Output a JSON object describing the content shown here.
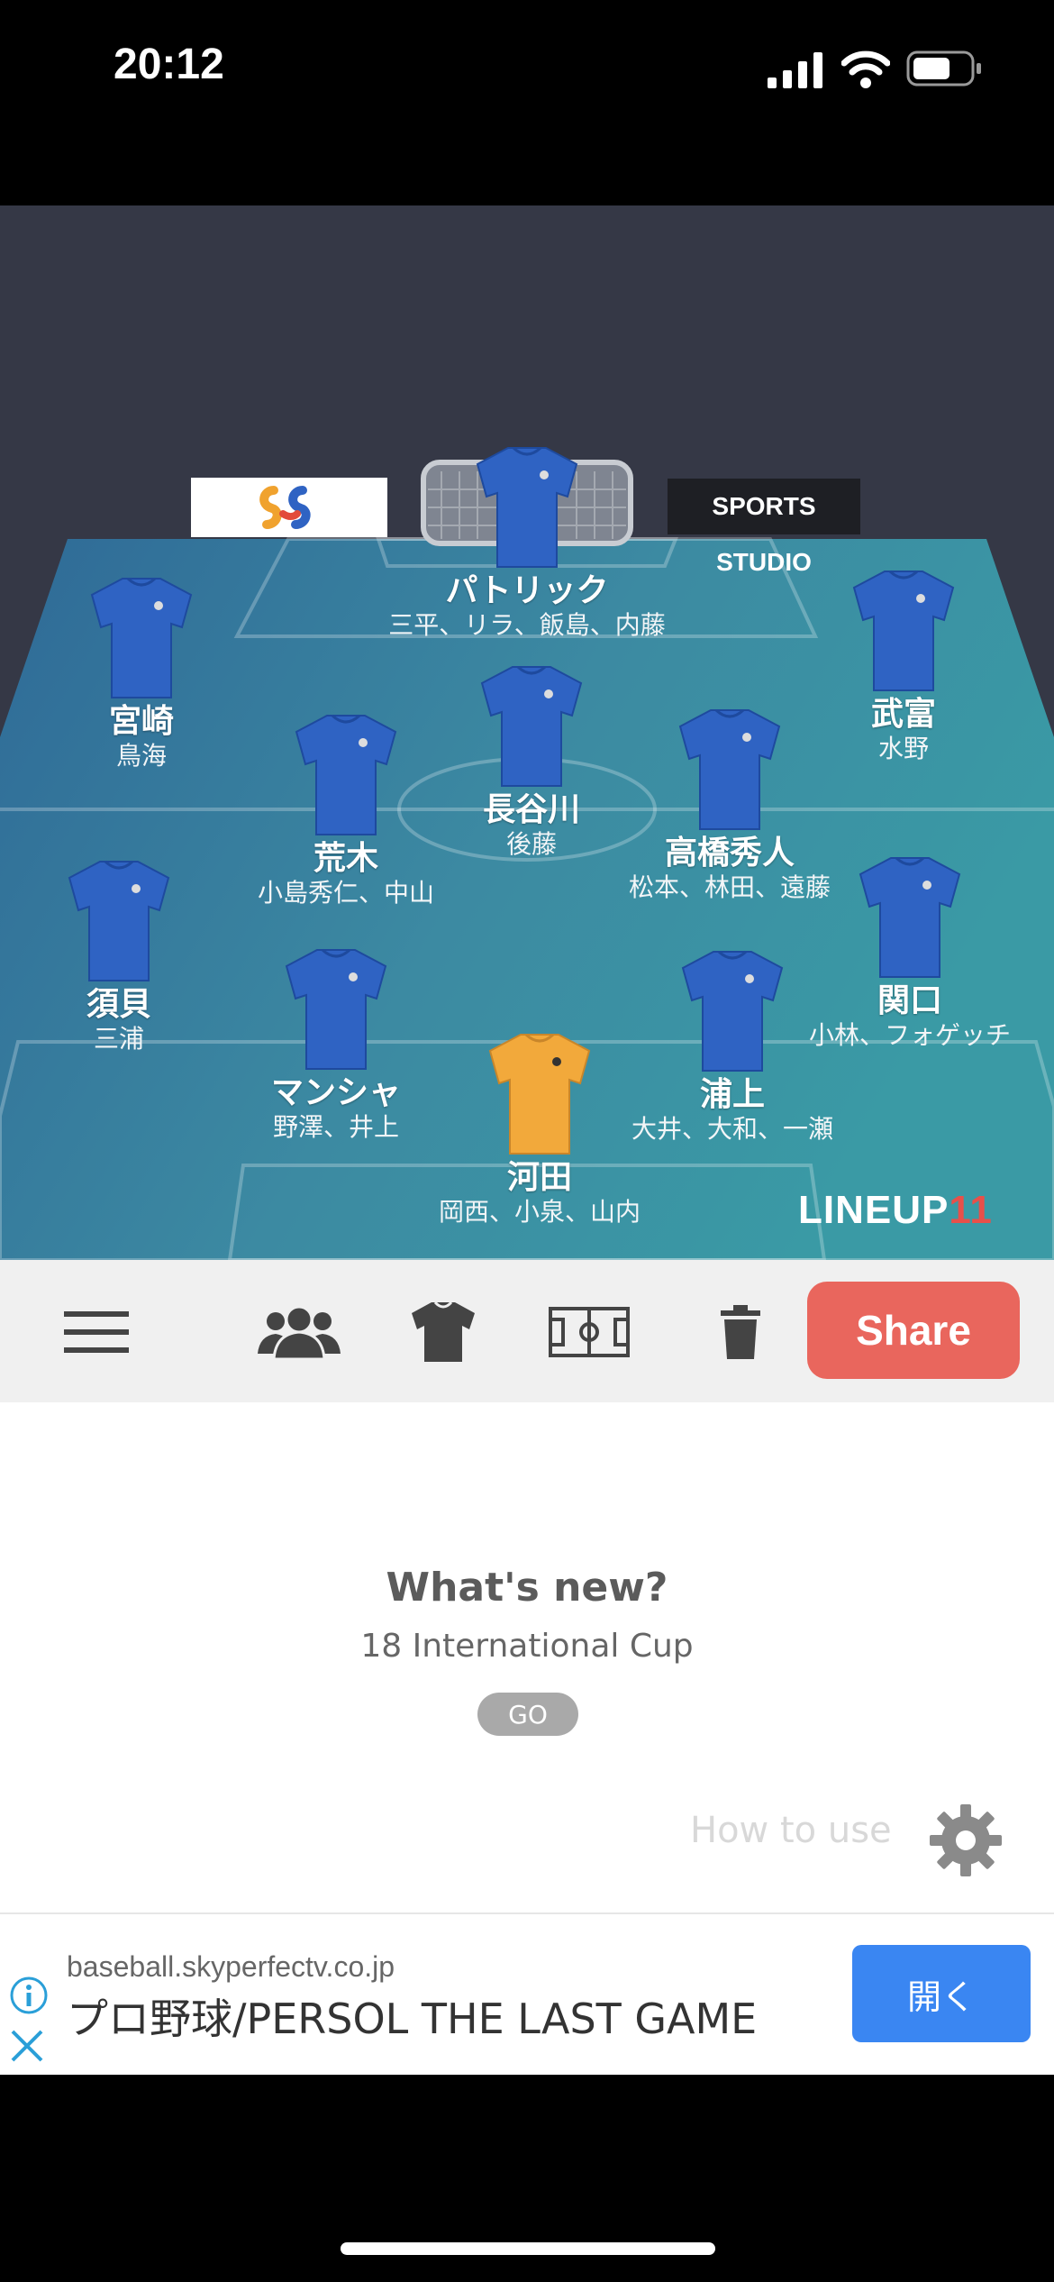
{
  "status_bar": {
    "time": "20:12"
  },
  "pitch": {
    "sponsor_right": "SPORTS STUDIO",
    "logo_main": "LINEUP",
    "logo_num": "11",
    "players": [
      {
        "name": "パトリック",
        "subs": "三平、リラ、飯島、内藤",
        "kit": "field"
      },
      {
        "name": "宮崎",
        "subs": "鳥海",
        "kit": "field"
      },
      {
        "name": "武富",
        "subs": "水野",
        "kit": "field"
      },
      {
        "name": "長谷川",
        "subs": "後藤",
        "kit": "field"
      },
      {
        "name": "荒木",
        "subs": "小島秀仁、中山",
        "kit": "field"
      },
      {
        "name": "高橋秀人",
        "subs": "松本、林田、遠藤",
        "kit": "field"
      },
      {
        "name": "須貝",
        "subs": "三浦",
        "kit": "field"
      },
      {
        "name": "関口",
        "subs": "小林、フォゲッチ",
        "kit": "field"
      },
      {
        "name": "マンシャ",
        "subs": "野澤、井上",
        "kit": "field"
      },
      {
        "name": "浦上",
        "subs": "大井、大和、一瀬",
        "kit": "field"
      },
      {
        "name": "河田",
        "subs": "岡西、小泉、山内",
        "kit": "goalkeeper"
      }
    ]
  },
  "toolbar": {
    "share_label": "Share"
  },
  "whats_new": {
    "title": "What's new?",
    "subtitle": "18 International Cup",
    "go_label": "GO"
  },
  "how_to_use": "How to use",
  "ad": {
    "domain": "baseball.skyperfectv.co.jp",
    "title": "プロ野球/PERSOL THE LAST GAME",
    "open_label": "開く"
  },
  "colors": {
    "field_kit": "#2f63c3",
    "goalkeeper_kit": "#f2a93b",
    "share": "#e9665d",
    "ad_button": "#3a86f2"
  }
}
